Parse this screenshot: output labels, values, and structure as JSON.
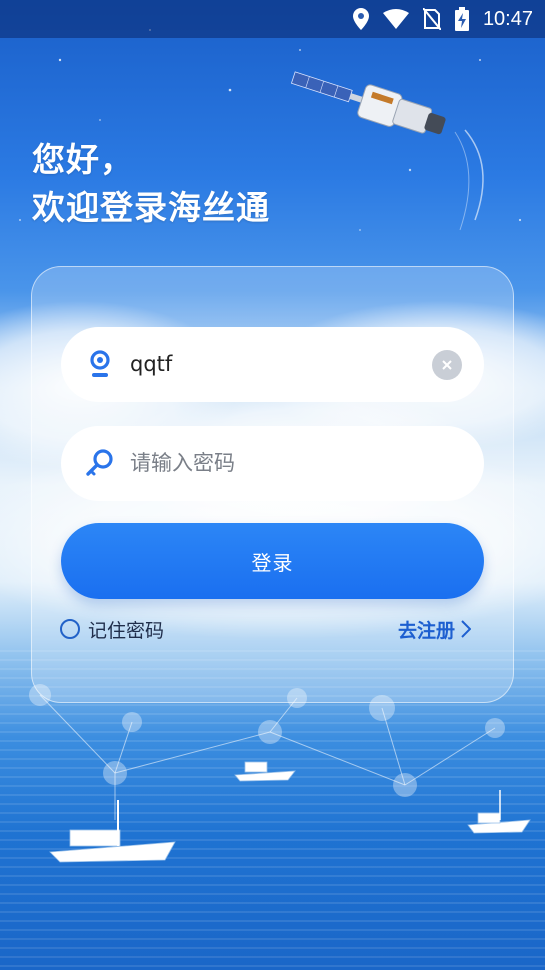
{
  "status_bar": {
    "time": "10:47",
    "icons": [
      "location-icon",
      "wifi-icon",
      "no-sim-icon",
      "battery-charging-icon"
    ]
  },
  "greeting": {
    "line1": "您好，",
    "line2": "欢迎登录海丝通"
  },
  "login_form": {
    "username": {
      "value": "qqtf",
      "icon": "user-icon"
    },
    "password": {
      "placeholder": "请输入密码",
      "icon": "key-icon"
    },
    "login_button_label": "登录",
    "remember_label": "记住密码",
    "remember_checked": false,
    "register_label": "去注册"
  },
  "colors": {
    "primary": "#1a6ff0",
    "link": "#1d5fd0",
    "sky_top": "#1a5fc9",
    "sea": "#1f73d2"
  }
}
